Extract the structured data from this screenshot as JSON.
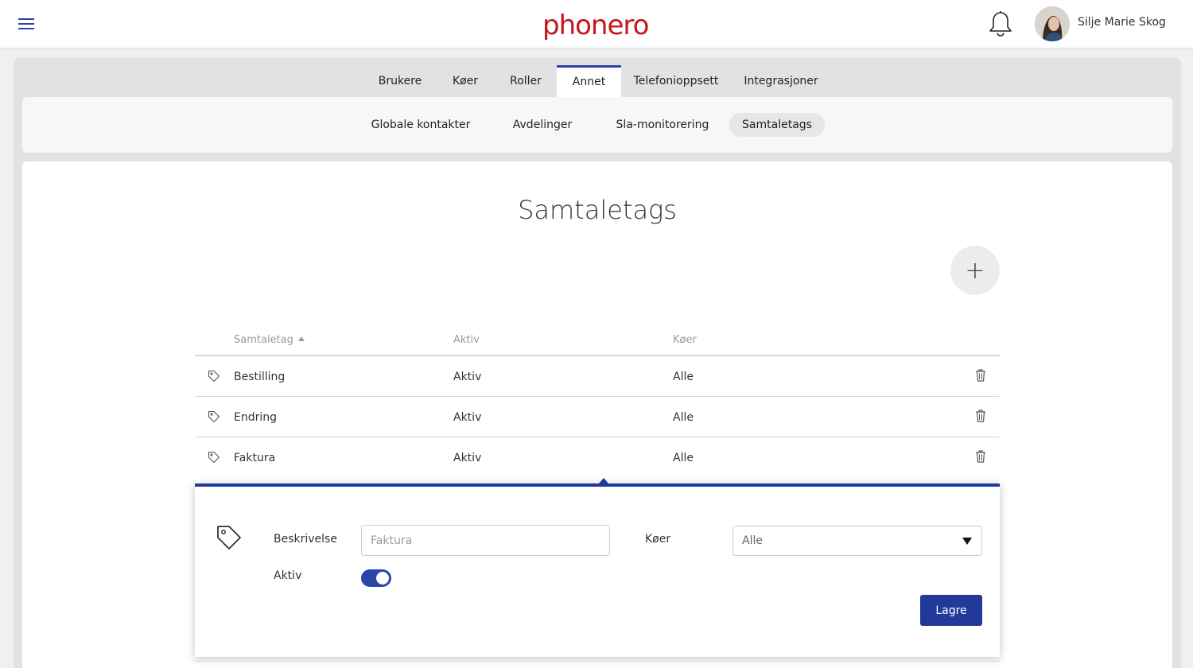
{
  "header": {
    "logo_text": "phonero",
    "user_name": "Silje Marie Skog",
    "accent_color": "#2a44a8",
    "brand_color": "#c4161c"
  },
  "tabs": [
    {
      "label": "Brukere",
      "active": false
    },
    {
      "label": "Køer",
      "active": false
    },
    {
      "label": "Roller",
      "active": false
    },
    {
      "label": "Annet",
      "active": true
    },
    {
      "label": "Telefonioppsett",
      "active": false
    },
    {
      "label": "Integrasjoner",
      "active": false
    }
  ],
  "subtabs": [
    {
      "label": "Globale kontakter",
      "active": false
    },
    {
      "label": "Avdelinger",
      "active": false
    },
    {
      "label": "Sla-monitorering",
      "active": false
    },
    {
      "label": "Samtaletags",
      "active": true
    }
  ],
  "page": {
    "title": "Samtaletags",
    "add_label": "+"
  },
  "table": {
    "columns": [
      "Samtaletag",
      "Aktiv",
      "Køer"
    ],
    "sort_column": "Samtaletag",
    "sort_direction": "ascending",
    "rows": [
      {
        "name": "Bestilling",
        "status": "Aktiv",
        "queues": "Alle"
      },
      {
        "name": "Endring",
        "status": "Aktiv",
        "queues": "Alle"
      },
      {
        "name": "Faktura",
        "status": "Aktiv",
        "queues": "Alle"
      }
    ]
  },
  "edit_panel": {
    "description_label": "Beskrivelse",
    "description_placeholder": "Faktura",
    "queues_label": "Køer",
    "queues_value": "Alle",
    "active_label": "Aktiv",
    "active_on": true,
    "save_label": "Lagre"
  }
}
